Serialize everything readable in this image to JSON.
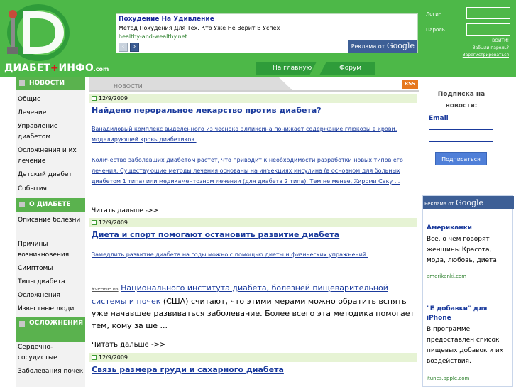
{
  "header": {
    "site_name": "ДИАБЕТ",
    "site_plus": "+",
    "site_name2": "ИНФО",
    "site_domain": ".com",
    "nav_home": "На главную",
    "nav_forum": "Форум",
    "colors": {
      "brand_green": "#4db848",
      "dark_green": "#2f9c3a",
      "link_blue": "#1a3a9c"
    }
  },
  "ad_top": {
    "title": "Похудение На Удивление",
    "desc": "Метод Похудения Для Тех. Кто Уже Не Верит В Успех",
    "url": "healthy-and-wealthy.net",
    "badge_prefix": "Реклама от",
    "badge_brand": "Google",
    "prev_icon": "chevron-left-icon",
    "next_icon": "chevron-right-icon"
  },
  "login": {
    "login_label": "Логин",
    "password_label": "Пароль",
    "login_value": "",
    "password_value": "",
    "submit_label": "ВОЙТИ!",
    "forgot_label": "Забыли пароль?",
    "register_label": "Зарегистрироваться"
  },
  "sidebar": {
    "sections": [
      {
        "title": "НОВОСТИ",
        "items": [
          "Общие",
          "Лечение",
          "Управление диабетом",
          "Осложнения и их лечение",
          "Детский диабет",
          "События"
        ]
      },
      {
        "title": "О ДИАБЕТЕ",
        "items": [
          "Описание болезни",
          "Причины возникновения",
          "Симптомы",
          "Типы диабета",
          "Осложнения",
          "Известные люди"
        ]
      },
      {
        "title": "ОСЛОЖНЕНИЯ",
        "items": [
          "Сердечно-сосудистые",
          "Заболевания почек"
        ]
      }
    ]
  },
  "main": {
    "tab_label": "НОВОСТИ",
    "rss_label": "RSS",
    "articles": [
      {
        "date": "12/9/2009",
        "title": "Найдено пероральное лекарство против диабета?",
        "p1": "Ванадиловый комплекс выделенного из чеснока алликсина понижает содержание глюкозы в крови, моделирующей кровь диабетиков.",
        "p2": "Количество заболевших диабетом растет, что приводит к необходимости разработки новых типов его лечения. Существующие методы лечения основаны на инъекциях инсулина (в основном для больных диабетом 1 типа) или медикаментозном лечении (для диабета 2 типа). Тем не менее, Хироми Саку ...",
        "more": "Читать дальше ->>"
      },
      {
        "date": "12/9/2009",
        "title": "Диета и спорт помогают остановить развитие диабета",
        "p1": "Замедлить развитие диабета на годы можно с помощью диеты и физических упражнений.",
        "p2_small": "Ученые из",
        "p2_link": "Национального института диабета, болезней пищеварительной системы и почек",
        "p2_rest": "(США) считают, что этими мерами можно обратить вспять уже начавшее развиваться заболевание. Более всего эта методика помогает тем, кому за ше ...",
        "more": "Читать дальше ->>"
      },
      {
        "date": "12/9/2009",
        "title": "Связь размера груди и сахарного диабета"
      }
    ]
  },
  "right": {
    "subscribe_title": "Подписка на новости:",
    "email_label": "Email",
    "email_value": "",
    "subscribe_button": "Подписаться",
    "ad_badge_prefix": "Реклама от",
    "ad_badge_brand": "Google",
    "ads": [
      {
        "title": "Американки",
        "body": "Все, о чем говорят женщины Красота, мода, любовь, диета",
        "url": "amerikanki.com"
      },
      {
        "title": "\"Е добавки\" для iPhone",
        "body": "В программе предоставлен список пищевых добавок и их воздействия.",
        "url": "itunes.apple.com"
      }
    ]
  }
}
